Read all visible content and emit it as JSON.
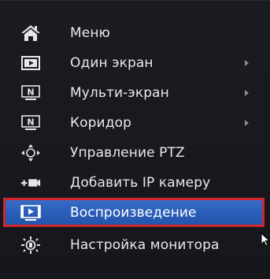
{
  "menu": {
    "items": [
      {
        "label": "Меню",
        "icon": "home-icon",
        "has_submenu": false,
        "selected": false
      },
      {
        "label": "Один экран",
        "icon": "single-screen-icon",
        "has_submenu": true,
        "selected": false
      },
      {
        "label": "Мульти-экран",
        "icon": "multi-screen-icon",
        "has_submenu": true,
        "selected": false
      },
      {
        "label": "Коридор",
        "icon": "corridor-icon",
        "has_submenu": true,
        "selected": false
      },
      {
        "label": "Управление PTZ",
        "icon": "ptz-control-icon",
        "has_submenu": false,
        "selected": false
      },
      {
        "label": "Добавить IP камеру",
        "icon": "add-ip-camera-icon",
        "has_submenu": false,
        "selected": false
      },
      {
        "label": "Воспроизведение",
        "icon": "playback-icon",
        "has_submenu": false,
        "selected": true
      },
      {
        "label": "Настройка монитора",
        "icon": "monitor-settings-icon",
        "has_submenu": false,
        "selected": false
      }
    ],
    "colors": {
      "background": "#17191e",
      "text": "#e9e9e9",
      "selection": "#2f62bd",
      "selection_border": "#d8262c"
    }
  }
}
